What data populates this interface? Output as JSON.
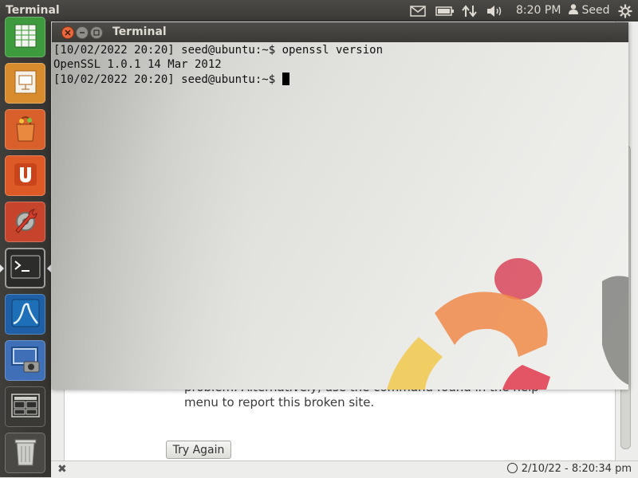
{
  "top_panel": {
    "app_title": "Terminal",
    "indicators": [
      "mail-icon",
      "battery-icon",
      "network-icon",
      "volume-icon"
    ],
    "clock": "8:20 PM",
    "user": "Seed",
    "settings_icon": "gear-icon"
  },
  "launcher": {
    "items": [
      {
        "name": "launcher-spreadsheet",
        "icon": "spreadsheet-icon"
      },
      {
        "name": "launcher-presentation",
        "icon": "presentation-icon"
      },
      {
        "name": "launcher-software-center",
        "icon": "shopping-bag-icon"
      },
      {
        "name": "launcher-ubuntu-one",
        "icon": "ubuntu-one-icon"
      },
      {
        "name": "launcher-system-settings",
        "icon": "wrench-gear-icon"
      },
      {
        "name": "launcher-terminal",
        "icon": "terminal-icon",
        "active": true
      },
      {
        "name": "launcher-wireshark",
        "icon": "wireshark-icon"
      },
      {
        "name": "launcher-screenshot",
        "icon": "screenshot-icon"
      },
      {
        "name": "launcher-workspace-switcher",
        "icon": "workspace-icon"
      },
      {
        "name": "launcher-trash",
        "icon": "trash-icon"
      }
    ]
  },
  "terminal": {
    "title": "Terminal",
    "lines": [
      "[10/02/2022 20:20] seed@ubuntu:~$ openssl version",
      "OpenSSL 1.0.1 14 Mar 2012",
      "[10/02/2022 20:20] seed@ubuntu:~$ "
    ]
  },
  "browser": {
    "error_line_1": "problem. Alternatively, use the command found in the help",
    "error_line_2": "menu to report this broken site.",
    "try_again_label": "Try Again",
    "status_close": "✖",
    "status_time": "2/10/22 - 8:20:34 pm"
  },
  "colors": {
    "panel": "#3c3b37",
    "launcher": "#3a3935",
    "ubuntu_orange": "#e95420",
    "close_button": "#e7683d"
  }
}
